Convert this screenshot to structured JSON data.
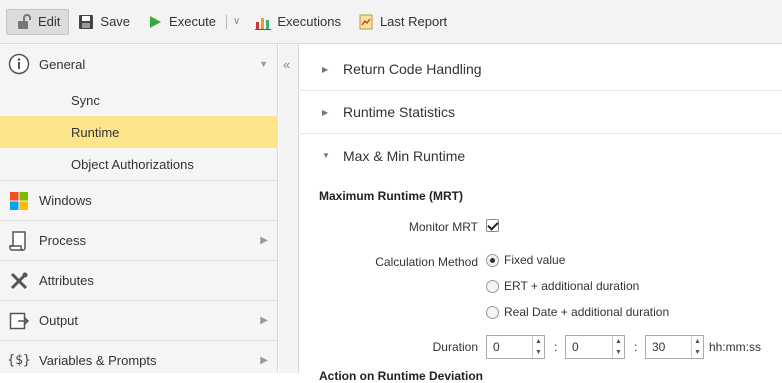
{
  "toolbar": {
    "edit": "Edit",
    "save": "Save",
    "execute": "Execute",
    "executions": "Executions",
    "last_report": "Last Report"
  },
  "sidebar": {
    "general": "General",
    "sub_items": [
      "Sync",
      "Runtime",
      "Object Authorizations"
    ],
    "active_sub": "Runtime",
    "items": [
      "Windows",
      "Process",
      "Attributes",
      "Output",
      "Variables & Prompts"
    ]
  },
  "sections": {
    "return_code": "Return Code Handling",
    "runtime_stats": "Runtime Statistics",
    "max_min": "Max & Min Runtime"
  },
  "mrt": {
    "title": "Maximum Runtime (MRT)",
    "monitor_label": "Monitor MRT",
    "monitor_checked": true,
    "calc_label": "Calculation Method",
    "options": [
      "Fixed value",
      "ERT + additional duration",
      "Real Date + additional duration"
    ],
    "selected_option": "Fixed value",
    "duration_label": "Duration",
    "hours": "0",
    "minutes": "0",
    "seconds": "30",
    "unit": "hh:mm:ss",
    "next_heading": "Action on Runtime Deviation"
  },
  "colors": {
    "active_bg": "#fde58b",
    "execute_green": "#3cab3c",
    "toolbar_bg": "#f3f3f3"
  }
}
